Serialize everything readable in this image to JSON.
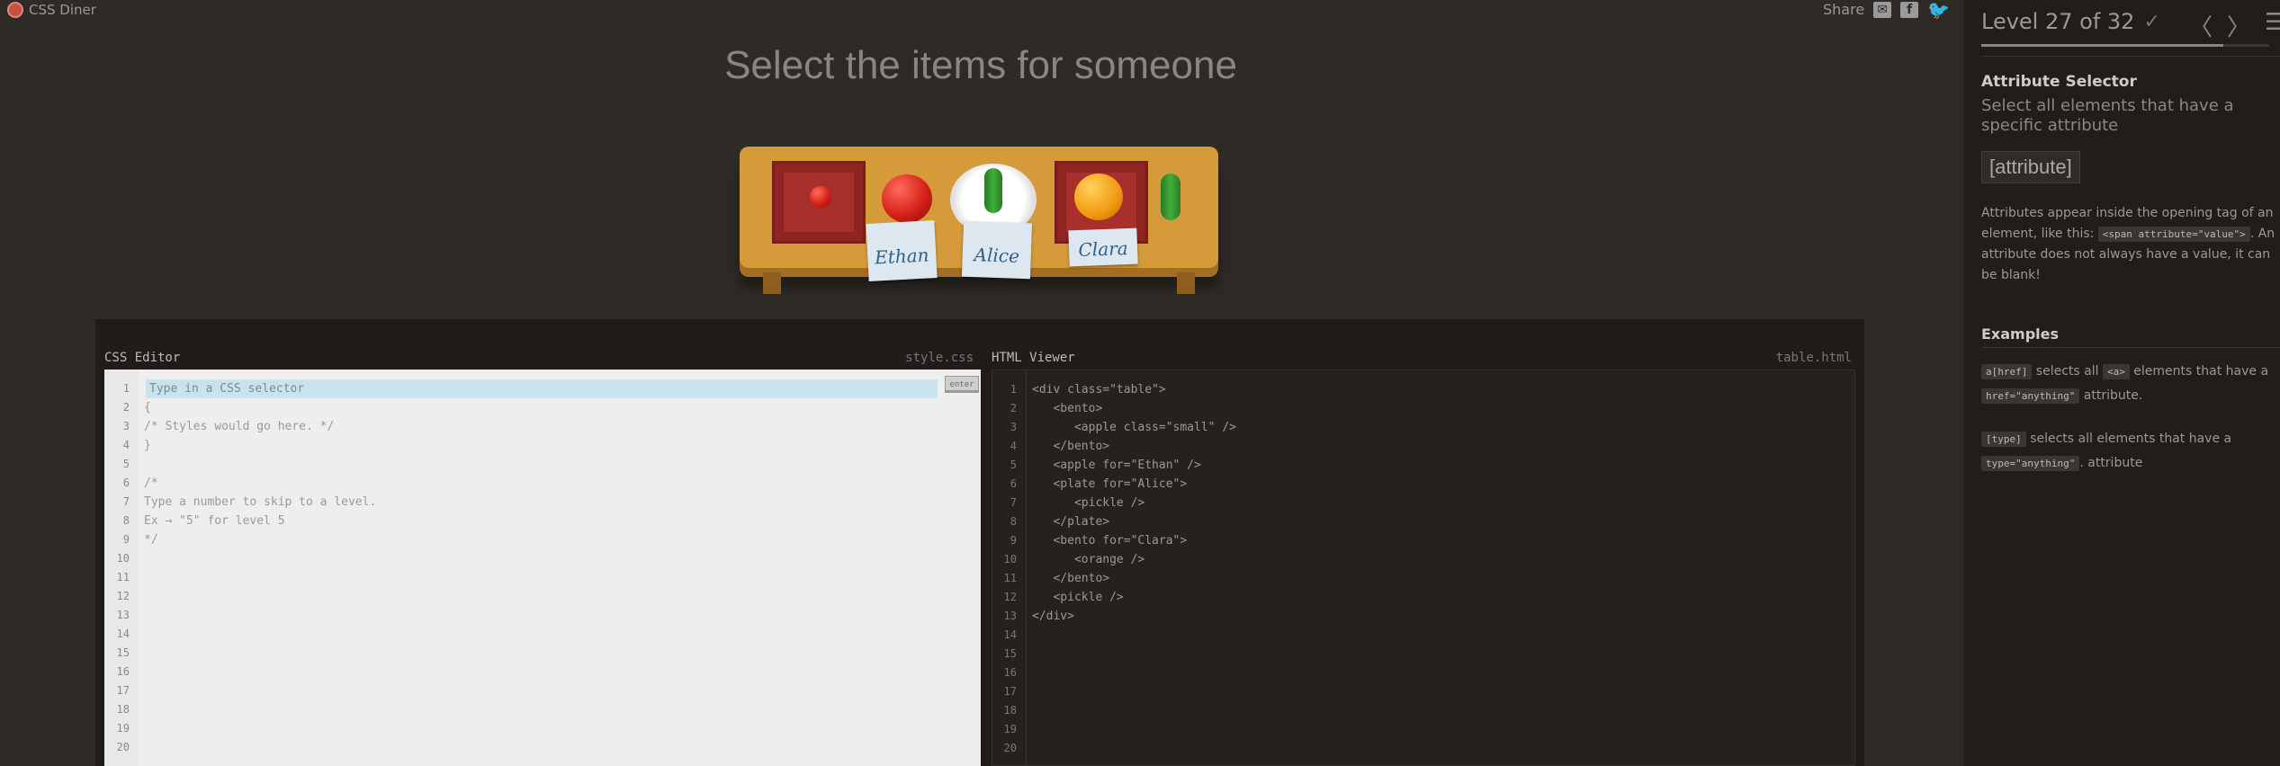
{
  "app": {
    "name": "CSS Diner"
  },
  "share": {
    "label": "Share"
  },
  "page": {
    "instruction": "Select the items for someone"
  },
  "table": {
    "cards": [
      "Ethan",
      "Alice",
      "Clara"
    ]
  },
  "css_editor": {
    "title": "CSS Editor",
    "filename": "style.css",
    "placeholder": "Type in a CSS selector",
    "enter_label": "enter",
    "line_numbers": [
      "1",
      "2",
      "3",
      "4",
      "5",
      "6",
      "7",
      "8",
      "9",
      "10",
      "11",
      "12",
      "13",
      "14",
      "15",
      "16",
      "17",
      "18",
      "19",
      "20"
    ],
    "code": "\n{\n/* Styles would go here. */\n}\n\n/*\nType a number to skip to a level.\nEx → \"5\" for level 5\n*/"
  },
  "html_viewer": {
    "title": "HTML Viewer",
    "filename": "table.html",
    "line_numbers": [
      "1",
      "2",
      "3",
      "4",
      "5",
      "6",
      "7",
      "8",
      "9",
      "10",
      "11",
      "12",
      "13",
      "14",
      "15",
      "16",
      "17",
      "18",
      "19",
      "20"
    ],
    "code": "<div class=\"table\">\n   <bento>\n      <apple class=\"small\" />\n   </bento>\n   <apple for=\"Ethan\" />\n   <plate for=\"Alice\">\n      <pickle />\n   </plate>\n   <bento for=\"Clara\">\n      <orange />\n   </bento>\n   <pickle />\n</div>"
  },
  "sidebar": {
    "level_text": "Level 27 of 32",
    "progress_fraction": 0.84,
    "selector_name": "Attribute Selector",
    "selector_title": "Select all elements that have a specific attribute",
    "syntax": "[attribute]",
    "hint_before": "Attributes appear inside the opening tag of an element, like this: ",
    "hint_code": "<span attribute=\"value\">",
    "hint_after": ". An attribute does not always have a value, it can be blank!",
    "examples_heading": "Examples",
    "example1_code1": "a[href]",
    "example1_text1": " selects all ",
    "example1_code2": "<a>",
    "example1_text2": " elements that have a ",
    "example1_code3": "href=\"anything\"",
    "example1_text3": " attribute.",
    "example2_code1": "[type]",
    "example2_text1": " selects all elements that have a ",
    "example2_code2": "type=\"anything\"",
    "example2_text2": ". attribute"
  }
}
